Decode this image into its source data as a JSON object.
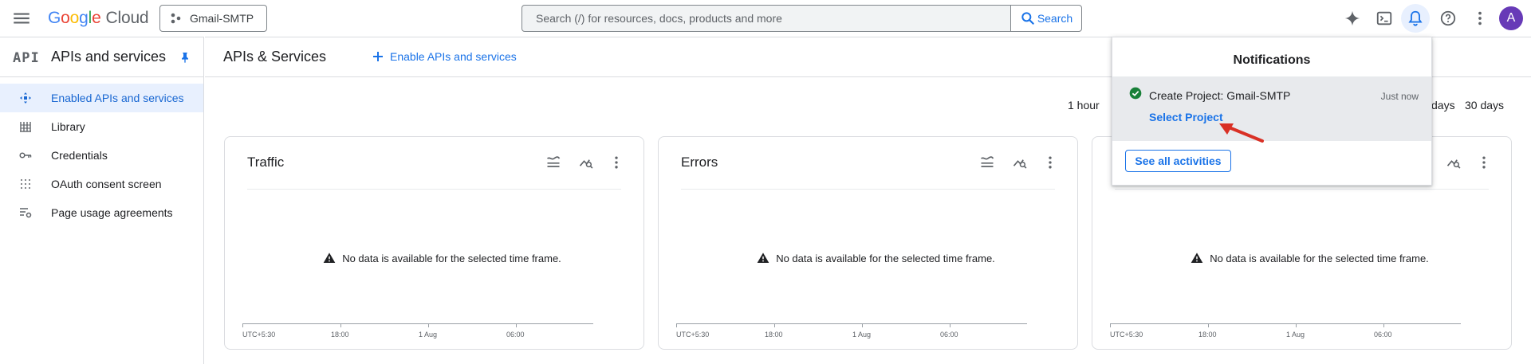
{
  "topbar": {
    "logo_google": "Google",
    "logo_cloud": "Cloud",
    "project_name": "Gmail-SMTP",
    "search_placeholder": "Search (/) for resources, docs, products and more",
    "search_button": "Search",
    "avatar_initial": "A"
  },
  "sidebar": {
    "title": "APIs and services",
    "logo": "API",
    "items": [
      {
        "label": "Enabled APIs and services",
        "icon": "diamond-arrows-icon",
        "active": true
      },
      {
        "label": "Library",
        "icon": "library-icon",
        "active": false
      },
      {
        "label": "Credentials",
        "icon": "key-icon",
        "active": false
      },
      {
        "label": "OAuth consent screen",
        "icon": "dotted-grid-icon",
        "active": false
      },
      {
        "label": "Page usage agreements",
        "icon": "settings-list-icon",
        "active": false
      }
    ]
  },
  "main": {
    "title": "APIs & Services",
    "enable_link": "Enable APIs and services",
    "time_ranges": [
      "1 hour",
      "days",
      "30 days"
    ]
  },
  "cards": [
    {
      "title": "Traffic",
      "nodata": "No data is available for the selected time frame.",
      "ticks": [
        "UTC+5:30",
        "18:00",
        "1 Aug",
        "06:00"
      ]
    },
    {
      "title": "Errors",
      "nodata": "No data is available for the selected time frame.",
      "ticks": [
        "UTC+5:30",
        "18:00",
        "1 Aug",
        "06:00"
      ]
    },
    {
      "title": "",
      "nodata": "No data is available for the selected time frame.",
      "ticks": [
        "UTC+5:30",
        "18:00",
        "1 Aug",
        "06:00"
      ]
    }
  ],
  "notifications": {
    "title": "Notifications",
    "item_message": "Create Project: Gmail-SMTP",
    "item_time": "Just now",
    "item_link": "Select Project",
    "see_all": "See all activities"
  },
  "colors": {
    "accent": "#1a73e8",
    "active_bg": "#e8f0fe",
    "success": "#188038",
    "annotation_arrow": "#d93025",
    "avatar": "#673ab7"
  }
}
